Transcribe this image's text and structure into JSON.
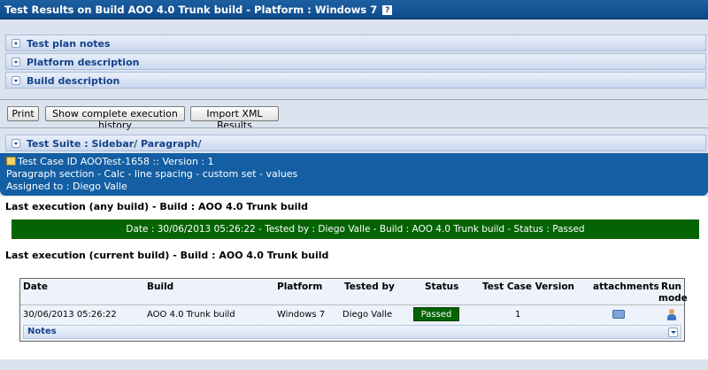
{
  "title": "Test Results on Build AOO 4.0 Trunk build - Platform : Windows 7",
  "help_icon": "?",
  "sections": {
    "test_plan_notes": "Test plan notes",
    "platform_description": "Platform description",
    "build_description": "Build description"
  },
  "toolbar": {
    "print": "Print",
    "history": "Show complete execution history",
    "import": "Import XML Results"
  },
  "test_suite": "Test Suite : Sidebar/ Paragraph/",
  "test_case": {
    "id_line": "Test Case ID AOOTest-1658 :: Version : 1",
    "name": "Paragraph section - Calc - line spacing - custom set - values",
    "assigned": "Assigned to : Diego Valle"
  },
  "last_any": {
    "heading": "Last execution (any build) - Build : AOO 4.0 Trunk build",
    "summary": "Date : 30/06/2013 05:26:22 - Tested by : Diego Valle - Build : AOO 4.0 Trunk build - Status : Passed",
    "status_color": "#046404"
  },
  "last_current": {
    "heading": "Last execution (current build) - Build : AOO 4.0 Trunk build"
  },
  "table": {
    "headers": {
      "date": "Date",
      "build": "Build",
      "platform": "Platform",
      "tested_by": "Tested by",
      "status": "Status",
      "version": "Test Case Version",
      "attachments": "attachments",
      "run": "Run",
      "mode": "mode"
    },
    "row": {
      "date": "30/06/2013 05:26:22",
      "build": "AOO 4.0 Trunk build",
      "platform": "Windows 7",
      "tested_by": "Diego Valle",
      "status": "Passed",
      "version": "1"
    },
    "notes": "Notes"
  },
  "icons": {
    "attachment": "attachment-icon",
    "run_mode": "user-icon"
  }
}
